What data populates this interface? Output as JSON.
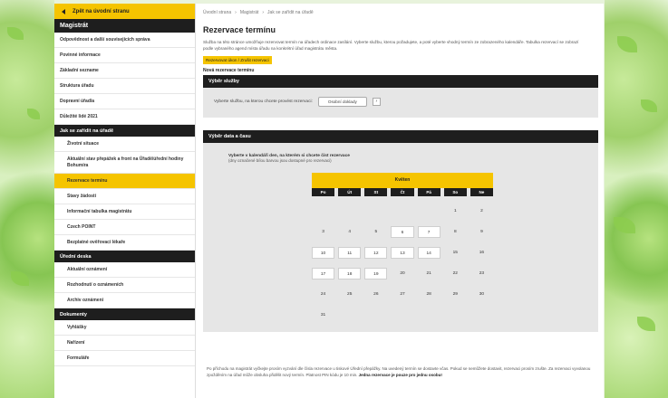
{
  "sidebar": {
    "back_label": "Zpět na úvodní stranu",
    "heading": "Magistrát",
    "items": [
      "Odpovědnost a další souvisejících správa",
      "Povinné informace",
      "Základní sezname",
      "Struktura úřadu",
      "Dopravní úřad/a",
      "Důležité lidé 2021"
    ],
    "section_jak": "Jak se zařídit na úřadě",
    "jak_items": [
      "Životní situace",
      "Aktuální stav přepážek a front na Úřadě/úřední hodiny Bohumíra",
      "Rezervace termínu",
      "Stavy žádostí",
      "Informační tabulka magistrátu",
      "Czech POINT",
      "Bezplatné ověřovací lékaře"
    ],
    "section_uredni": "Úřední deska",
    "uredni_items": [
      "Aktuální oznámení",
      "Rozhodnutí o oznámeních",
      "Archiv oznámení"
    ],
    "section_dokumenty": "Dokumenty",
    "dok_items": [
      "Vyhlášky",
      "Nařízení",
      "Formuláře"
    ]
  },
  "breadcrumbs": [
    "Úvodní strana",
    "Magistrát",
    "Jak se zařídit na úřadě"
  ],
  "page_title": "Rezervace termínu",
  "intro_text": "Služba na této stránce umožňuje rezervovat termín na úřadech ordinace zasílání. Vyberte službu, kterou požadujete, a poté vyberte vhodný termín ze zobrazeného kalendáře. Tabulka rezervací se zobrazí podle vybraného agend místa úřadu na konkrétní úřad magistrátu města.",
  "yellow_link": "Rezervovat úkon / Zrušit rezervaci",
  "new_reservation_label": "Nová rezervace termínu",
  "service_section": {
    "title": "Výběr služby",
    "prompt": "Vyberte službu, na kterou chcete provést rezervaci:",
    "select_value": "Osobní doklady",
    "button_glyph": "›"
  },
  "date_section": {
    "title": "Výběr data a času",
    "note_title": "Vyberte v kalendáři den, na kterém si chcete číst rezervace",
    "note_text": "(dny označené bílou barvou jsou dostupné pro rezervaci)"
  },
  "calendar": {
    "month": "Květen",
    "weekdays": [
      "Po",
      "Út",
      "St",
      "Čt",
      "Pá",
      "So",
      "Ne"
    ],
    "days": [
      {
        "d": "",
        "a": false
      },
      {
        "d": "",
        "a": false
      },
      {
        "d": "",
        "a": false
      },
      {
        "d": "",
        "a": false
      },
      {
        "d": "",
        "a": false
      },
      {
        "d": "1",
        "a": false
      },
      {
        "d": "2",
        "a": false
      },
      {
        "d": "3",
        "a": false
      },
      {
        "d": "4",
        "a": false
      },
      {
        "d": "5",
        "a": false
      },
      {
        "d": "6",
        "a": true
      },
      {
        "d": "7",
        "a": true
      },
      {
        "d": "8",
        "a": false
      },
      {
        "d": "9",
        "a": false
      },
      {
        "d": "10",
        "a": true
      },
      {
        "d": "11",
        "a": true
      },
      {
        "d": "12",
        "a": true
      },
      {
        "d": "13",
        "a": true
      },
      {
        "d": "14",
        "a": true
      },
      {
        "d": "15",
        "a": false
      },
      {
        "d": "16",
        "a": false
      },
      {
        "d": "17",
        "a": true
      },
      {
        "d": "18",
        "a": true
      },
      {
        "d": "19",
        "a": true
      },
      {
        "d": "20",
        "a": false
      },
      {
        "d": "21",
        "a": false
      },
      {
        "d": "22",
        "a": false
      },
      {
        "d": "23",
        "a": false
      },
      {
        "d": "24",
        "a": false
      },
      {
        "d": "25",
        "a": false
      },
      {
        "d": "26",
        "a": false
      },
      {
        "d": "27",
        "a": false
      },
      {
        "d": "28",
        "a": false
      },
      {
        "d": "29",
        "a": false
      },
      {
        "d": "30",
        "a": false
      },
      {
        "d": "31",
        "a": false
      }
    ]
  },
  "footer": {
    "text": "Po příchodu na magistrát vyčkejte prosím vyzvání dle čísla rezervace u tiskové Úřední přepážky. Na uvedený termín se dostavte včas. Pokud se nemůžete dostavit, rezervaci prosím zrušte. Za rezervaci vyvolanou zpožděním na úřad může obsluha přidělit nový termín. Platnost PIN kódu je 10 min.",
    "bold": "Jedna rezervace je pouze pro jednu osobu!"
  }
}
